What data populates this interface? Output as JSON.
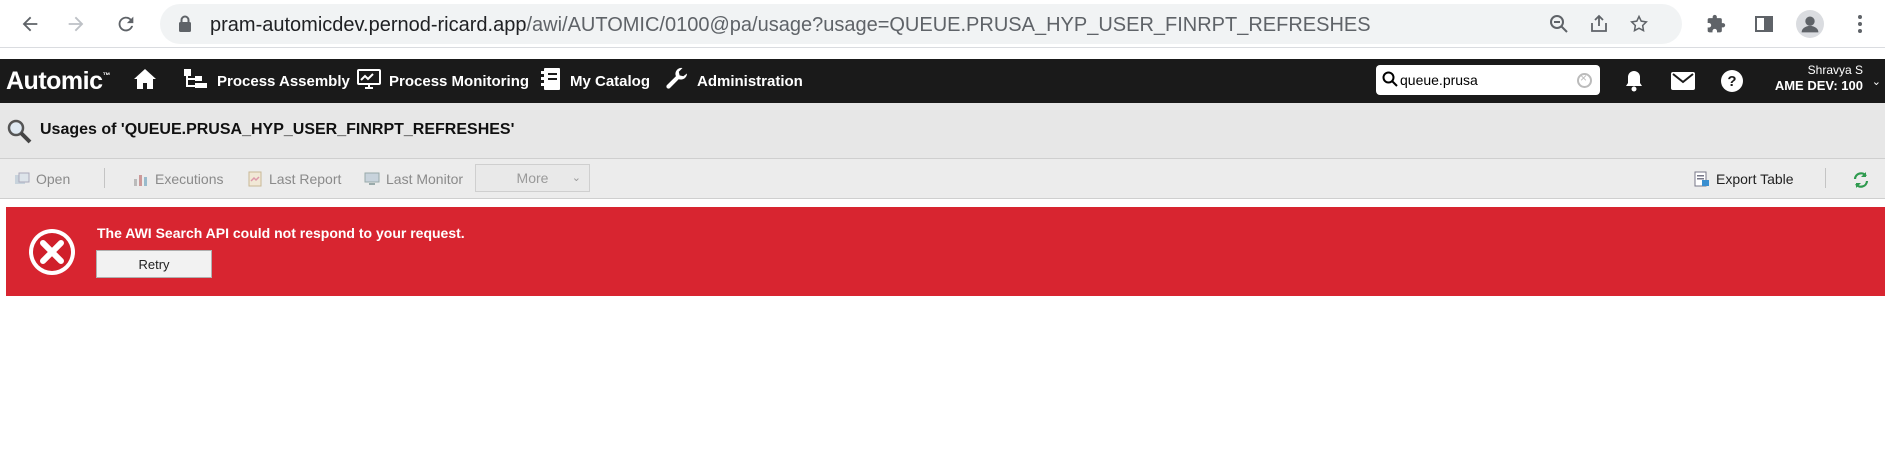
{
  "browser": {
    "url_host": "pram-automicdev.pernod-ricard.app",
    "url_path": "/awi/AUTOMIC/0100@pa/usage?usage=QUEUE.PRUSA_HYP_USER_FINRPT_REFRESHES"
  },
  "header": {
    "brand": "Automic",
    "brand_tm": "™",
    "nav": [
      {
        "label": "Process Assembly",
        "icon": "process-assembly-icon"
      },
      {
        "label": "Process Monitoring",
        "icon": "monitor-icon"
      },
      {
        "label": "My Catalog",
        "icon": "catalog-icon"
      },
      {
        "label": "Administration",
        "icon": "wrench-icon"
      }
    ],
    "search_value": "queue.prusa",
    "user_name": "Shravya S",
    "environment": "AME DEV: 100"
  },
  "title_bar": {
    "title": "Usages of 'QUEUE.PRUSA_HYP_USER_FINRPT_REFRESHES'"
  },
  "toolbar": {
    "open": "Open",
    "executions": "Executions",
    "last_report": "Last Report",
    "last_monitor": "Last Monitor",
    "more": "More",
    "export_table": "Export Table"
  },
  "error": {
    "message": "The AWI Search API could not respond to your request.",
    "retry": "Retry",
    "color": "#d82530"
  }
}
